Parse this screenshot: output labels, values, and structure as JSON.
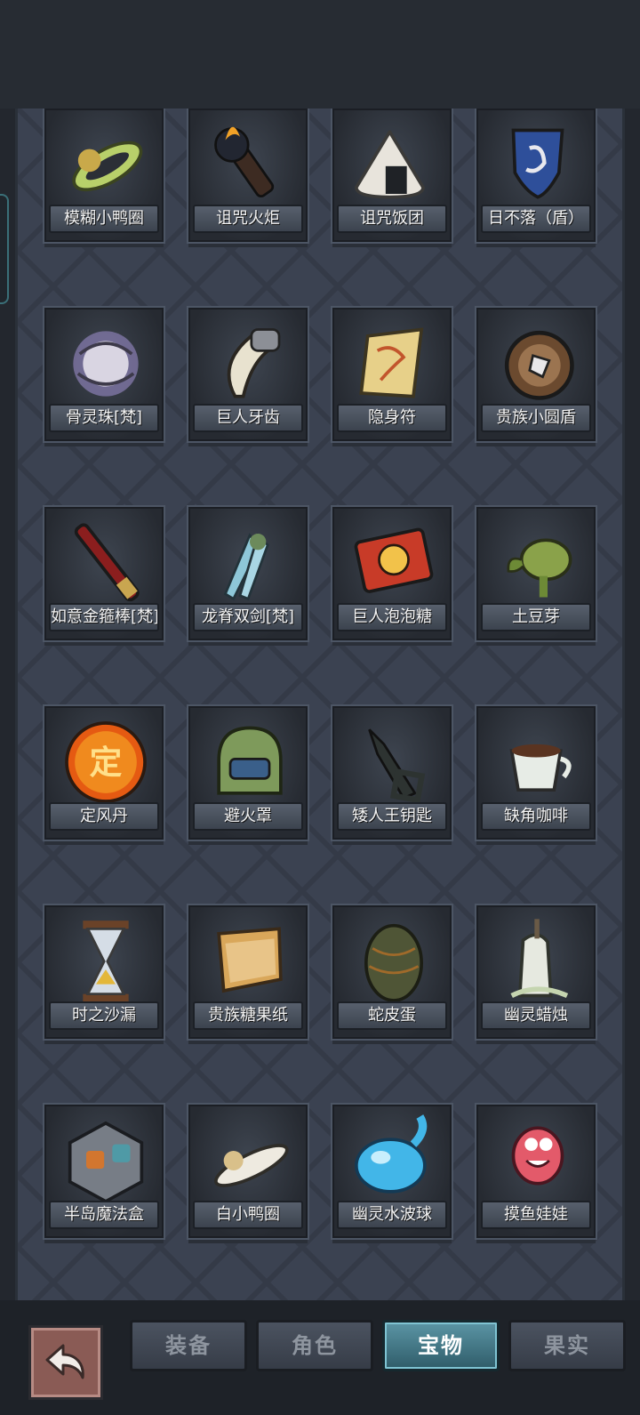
{
  "items": [
    {
      "label": "模糊小鸭圈",
      "icon": "yellow-duck-ring-icon"
    },
    {
      "label": "诅咒火炬",
      "icon": "cursed-torch-icon"
    },
    {
      "label": "诅咒饭团",
      "icon": "cursed-rice-ball-icon"
    },
    {
      "label": "日不落（盾）",
      "icon": "blue-shield-icon"
    },
    {
      "label": "骨灵珠[梵]",
      "icon": "bone-spirit-orb-icon"
    },
    {
      "label": "巨人牙齿",
      "icon": "giant-tooth-icon"
    },
    {
      "label": "隐身符",
      "icon": "invisibility-talisman-icon"
    },
    {
      "label": "贵族小圆盾",
      "icon": "round-shield-icon"
    },
    {
      "label": "如意金箍棒[梵]",
      "icon": "golden-staff-icon"
    },
    {
      "label": "龙脊双剑[梵]",
      "icon": "dragon-twin-swords-icon"
    },
    {
      "label": "巨人泡泡糖",
      "icon": "bubblegum-box-icon"
    },
    {
      "label": "土豆芽",
      "icon": "potato-sprout-icon"
    },
    {
      "label": "定风丹",
      "icon": "wind-pill-orb-icon"
    },
    {
      "label": "避火罩",
      "icon": "fire-helmet-icon"
    },
    {
      "label": "矮人王钥匙",
      "icon": "dwarf-key-icon"
    },
    {
      "label": "缺角咖啡",
      "icon": "coffee-cup-icon"
    },
    {
      "label": "时之沙漏",
      "icon": "hourglass-icon"
    },
    {
      "label": "贵族糖果纸",
      "icon": "candy-paper-icon"
    },
    {
      "label": "蛇皮蛋",
      "icon": "snakeskin-egg-icon"
    },
    {
      "label": "幽灵蜡烛",
      "icon": "ghost-candle-icon"
    },
    {
      "label": "半岛魔法盒",
      "icon": "magic-cube-icon"
    },
    {
      "label": "白小鸭圈",
      "icon": "white-duck-ring-icon"
    },
    {
      "label": "幽灵水波球",
      "icon": "water-orb-icon"
    },
    {
      "label": "摸鱼娃娃",
      "icon": "pink-doll-icon"
    },
    {
      "label": "",
      "icon": "potion-bottle-icon"
    },
    {
      "label": "",
      "icon": "black-claws-icon"
    },
    {
      "label": "",
      "icon": "green-pyramid-icon"
    },
    {
      "label": "",
      "icon": "green-rune-stone-icon"
    }
  ],
  "orb_char": "定",
  "tabs": [
    {
      "label": "装备",
      "active": false
    },
    {
      "label": "角色",
      "active": false
    },
    {
      "label": "宝物",
      "active": true
    },
    {
      "label": "果实",
      "active": false
    }
  ],
  "colors": {
    "accent": "#4a8a9a",
    "panel": "#3b4251",
    "back_button": "#8a5b55"
  }
}
